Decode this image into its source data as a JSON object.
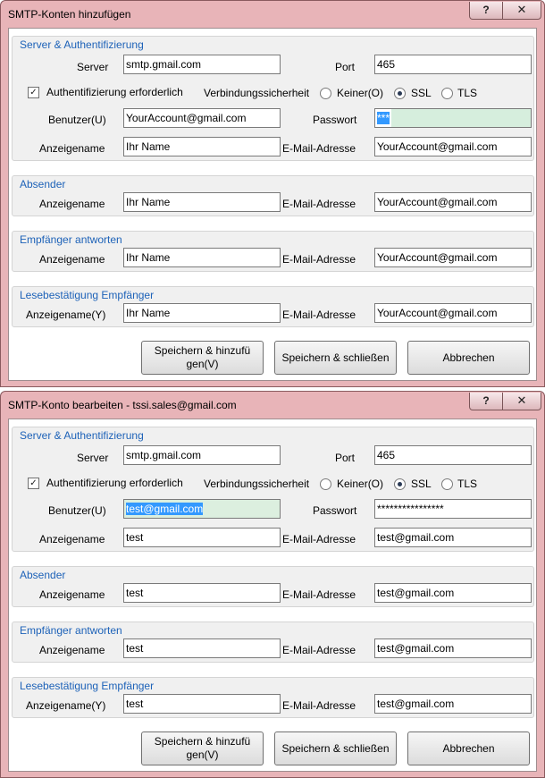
{
  "windows": [
    {
      "title": "SMTP-Konten hinzufügen",
      "help_glyph": "?",
      "close_glyph": "✕",
      "server_group": {
        "title": "Server & Authentifizierung",
        "server_label": "Server",
        "server_value": "smtp.gmail.com",
        "port_label": "Port",
        "port_value": "465",
        "auth_label": "Authentifizierung erforderlich",
        "auth_checked": true,
        "security_label": "Verbindungssicherheit",
        "opt_none": "Keiner(O)",
        "opt_ssl": "SSL",
        "opt_tls": "TLS",
        "selected": "SSL",
        "user_label": "Benutzer(U)",
        "user_value": "YourAccount@gmail.com",
        "password_label": "Passwort",
        "password_value": "***",
        "display_label": "Anzeigename",
        "display_value": "Ihr Name",
        "email_label": "E-Mail-Adresse",
        "email_value": "YourAccount@gmail.com"
      },
      "sender_group": {
        "title": "Absender",
        "display_label": "Anzeigename",
        "display_value": "Ihr Name",
        "email_label": "E-Mail-Adresse",
        "email_value": "YourAccount@gmail.com"
      },
      "reply_group": {
        "title": "Empfänger antworten",
        "display_label": "Anzeigename",
        "display_value": "Ihr Name",
        "email_label": "E-Mail-Adresse",
        "email_value": "YourAccount@gmail.com"
      },
      "receipt_group": {
        "title": "Lesebestätigung Empfänger",
        "display_label": "Anzeigename(Y)",
        "display_value": "Ihr Name",
        "email_label": "E-Mail-Adresse",
        "email_value": "YourAccount@gmail.com"
      },
      "buttons": {
        "save_add_line1": "Speichern & hinzufü",
        "save_add_line2": "gen(V)",
        "save_close": "Speichern & schließen",
        "cancel": "Abbrechen"
      }
    },
    {
      "title": "SMTP-Konto bearbeiten - tssi.sales@gmail.com",
      "help_glyph": "?",
      "close_glyph": "✕",
      "server_group": {
        "title": "Server & Authentifizierung",
        "server_label": "Server",
        "server_value": "smtp.gmail.com",
        "port_label": "Port",
        "port_value": "465",
        "auth_label": "Authentifizierung erforderlich",
        "auth_checked": true,
        "security_label": "Verbindungssicherheit",
        "opt_none": "Keiner(O)",
        "opt_ssl": "SSL",
        "opt_tls": "TLS",
        "selected": "SSL",
        "user_label": "Benutzer(U)",
        "user_value": "test@gmail.com",
        "password_label": "Passwort",
        "password_value": "****************",
        "display_label": "Anzeigename",
        "display_value": "test",
        "email_label": "E-Mail-Adresse",
        "email_value": "test@gmail.com"
      },
      "sender_group": {
        "title": "Absender",
        "display_label": "Anzeigename",
        "display_value": "test",
        "email_label": "E-Mail-Adresse",
        "email_value": "test@gmail.com"
      },
      "reply_group": {
        "title": "Empfänger antworten",
        "display_label": "Anzeigename",
        "display_value": "test",
        "email_label": "E-Mail-Adresse",
        "email_value": "test@gmail.com"
      },
      "receipt_group": {
        "title": "Lesebestätigung Empfänger",
        "display_label": "Anzeigename(Y)",
        "display_value": "test",
        "email_label": "E-Mail-Adresse",
        "email_value": "test@gmail.com"
      },
      "buttons": {
        "save_add_line1": "Speichern & hinzufü",
        "save_add_line2": "gen(V)",
        "save_close": "Speichern & schließen",
        "cancel": "Abbrechen"
      }
    }
  ]
}
